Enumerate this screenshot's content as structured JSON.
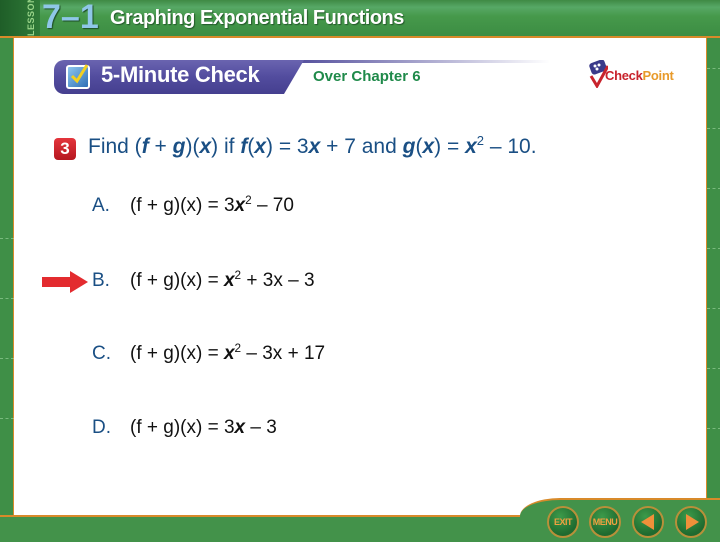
{
  "header": {
    "lesson_label": "LESSON",
    "lesson_number": "7–1",
    "lesson_title": "Graphing Exponential Functions"
  },
  "banner": {
    "title": "5-Minute Check",
    "subtitle": "Over Chapter 6",
    "logo_check": "Check",
    "logo_point": "Point"
  },
  "question": {
    "number": "3",
    "prefix": "Find (",
    "parts": {
      "f": "f",
      "plus": " + ",
      "g": "g",
      "close1": ")(",
      "x": "x",
      "close2": ") if ",
      "fx_f": "f",
      "fx_open": "(",
      "fx_x": "x",
      "fx_rest": ") = 3",
      "fx_x2": "x",
      "fx_end": " + 7 and ",
      "gx_g": "g",
      "gx_open": "(",
      "gx_x": "x",
      "gx_eq": ") = ",
      "gx_x2": "x",
      "gx_exp": "2",
      "gx_end": " – 10."
    }
  },
  "choices": [
    {
      "letter": "A.",
      "lhs": "(f + g)(x) = ",
      "rhs_pre": "3",
      "var": "x",
      "exp": "2",
      "rhs_post": " – 70",
      "correct": false
    },
    {
      "letter": "B.",
      "lhs": "(f + g)(x) = ",
      "rhs_pre": "",
      "var": "x",
      "exp": "2",
      "rhs_post": " + 3x – 3",
      "correct": true
    },
    {
      "letter": "C.",
      "lhs": "(f + g)(x) = ",
      "rhs_pre": "",
      "var": "x",
      "exp": "2",
      "rhs_post": " – 3x + 17",
      "correct": false
    },
    {
      "letter": "D.",
      "lhs": "(f + g)(x) = ",
      "rhs_pre": "3",
      "var": "x",
      "exp": "",
      "rhs_post": " – 3",
      "correct": false
    }
  ],
  "nav": {
    "exit": "EXIT",
    "menu": "MENU",
    "prev": "previous",
    "next": "next"
  },
  "colors": {
    "green": "#43924a",
    "accent_orange": "#d88a2a",
    "banner_purple": "#524c9e",
    "text_blue": "#1a4f84",
    "arrow_red": "#e32b2f"
  }
}
